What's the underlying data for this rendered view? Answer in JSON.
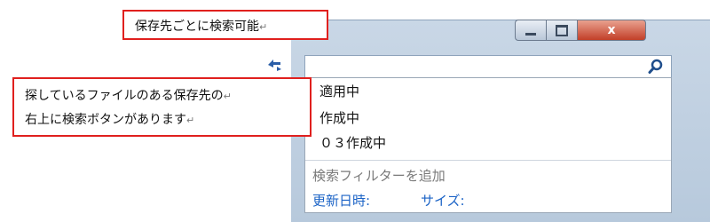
{
  "window": {
    "controls": {
      "minimize": "─",
      "maximize": "□",
      "close": "x"
    }
  },
  "search": {
    "value": ""
  },
  "dropdown": {
    "history": [
      "適用中",
      "作成中",
      "０３作成中"
    ],
    "filter_heading": "検索フィルターを追加",
    "filters": [
      "更新日時:",
      "サイズ:"
    ]
  },
  "annotations": {
    "top_callout": "保存先ごとに検索可能",
    "left_callout": [
      "探しているファイルのある保存先の",
      "右上に検索ボタンがあります"
    ],
    "return_mark": "↵"
  },
  "colors": {
    "callout_border": "#e0201e",
    "link": "#1b63c6",
    "close_button": "#c23f28"
  },
  "icons": {
    "search": "search-icon",
    "refresh": "refresh-arrow-icon"
  }
}
